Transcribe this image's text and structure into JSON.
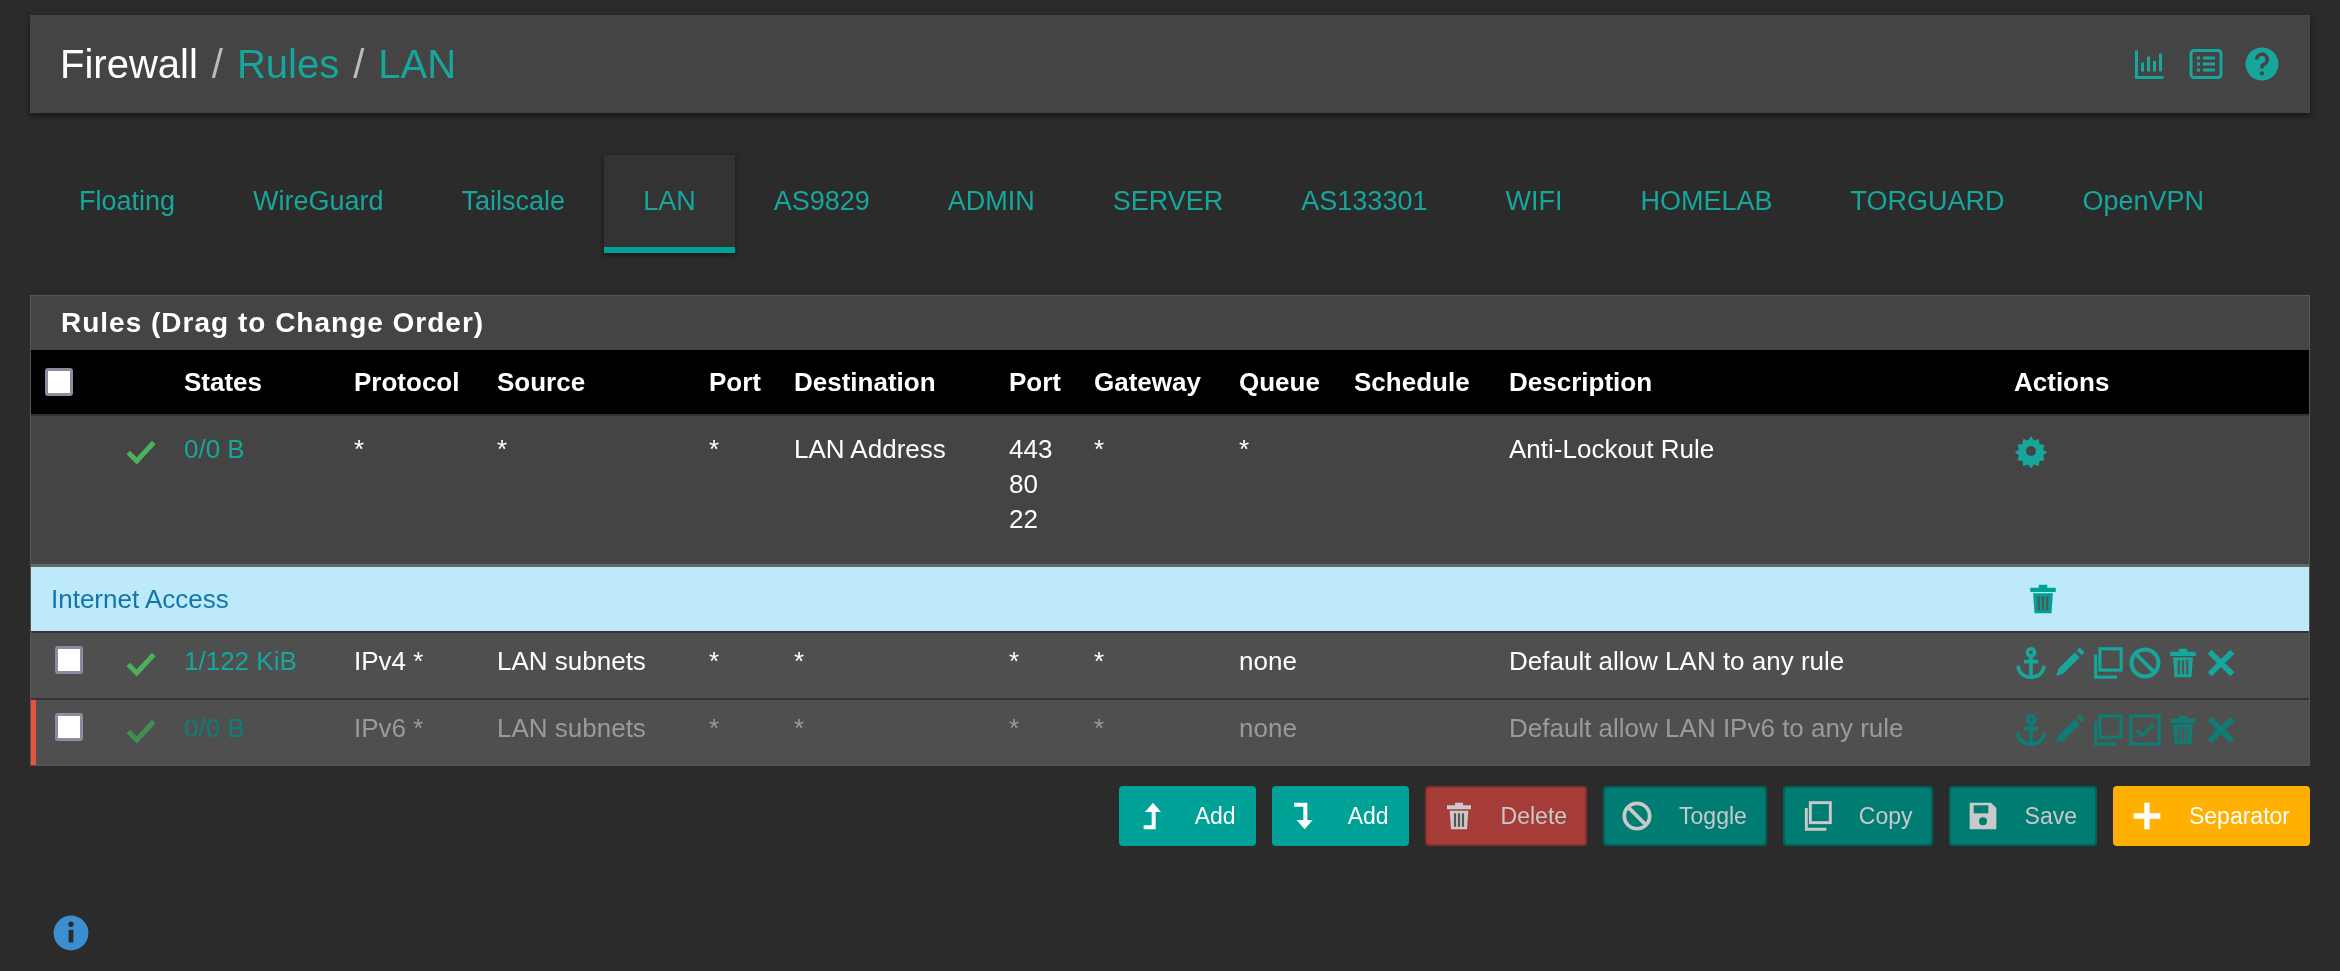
{
  "breadcrumb": [
    {
      "label": "Firewall",
      "link": false,
      "separator": "/"
    },
    {
      "label": "Rules",
      "link": true,
      "separator": "/"
    },
    {
      "label": "LAN",
      "link": true
    }
  ],
  "tabs": [
    {
      "label": "Floating",
      "selected": false
    },
    {
      "label": "WireGuard",
      "selected": false
    },
    {
      "label": "Tailscale",
      "selected": false
    },
    {
      "label": "LAN",
      "selected": true
    },
    {
      "label": "AS9829",
      "selected": false
    },
    {
      "label": "ADMIN",
      "selected": false
    },
    {
      "label": "SERVER",
      "selected": false
    },
    {
      "label": "AS133301",
      "selected": false
    },
    {
      "label": "WIFI",
      "selected": false
    },
    {
      "label": "HOMELAB",
      "selected": false
    },
    {
      "label": "TORGUARD",
      "selected": false
    },
    {
      "label": "OpenVPN",
      "selected": false
    }
  ],
  "panel": {
    "title": "Rules (Drag to Change Order)",
    "select_all": {
      "checked": false
    },
    "columns": [
      "States",
      "Protocol",
      "Source",
      "Port",
      "Destination",
      "Port",
      "Gateway",
      "Queue",
      "Schedule",
      "Description",
      "Actions"
    ],
    "rows": [
      {
        "kind": "system_rule",
        "states": "0/0 B",
        "protocol": "*",
        "source": "*",
        "source_port": "*",
        "destination": "LAN Address",
        "destination_port": [
          "443",
          "80",
          "22"
        ],
        "gateway": "*",
        "queue": "*",
        "description": "Anti-Lockout Rule"
      },
      {
        "kind": "separator",
        "label": "Internet Access"
      },
      {
        "kind": "rule",
        "checked": false,
        "disabled": false,
        "states": "1/122 KiB",
        "protocol": "IPv4 *",
        "source": "LAN subnets",
        "source_port": "*",
        "destination": "*",
        "destination_port": [
          "*"
        ],
        "gateway": "*",
        "queue": "none",
        "description": "Default allow LAN to any rule"
      },
      {
        "kind": "rule",
        "checked": false,
        "disabled": true,
        "states": "0/0 B",
        "protocol": "IPv6 *",
        "source": "LAN subnets",
        "source_port": "*",
        "destination": "*",
        "destination_port": [
          "*"
        ],
        "gateway": "*",
        "queue": "none",
        "description": "Default allow LAN IPv6 to any rule"
      }
    ]
  },
  "buttons": [
    {
      "kind": "add-top",
      "label": "Add",
      "disabled": false
    },
    {
      "kind": "add-bottom",
      "label": "Add",
      "disabled": false
    },
    {
      "kind": "delete",
      "label": "Delete",
      "disabled": true
    },
    {
      "kind": "toggle",
      "label": "Toggle",
      "disabled": true
    },
    {
      "kind": "copy",
      "label": "Copy",
      "disabled": true
    },
    {
      "kind": "save",
      "label": "Save",
      "disabled": true
    },
    {
      "kind": "separator",
      "label": "Separator",
      "disabled": false
    }
  ]
}
